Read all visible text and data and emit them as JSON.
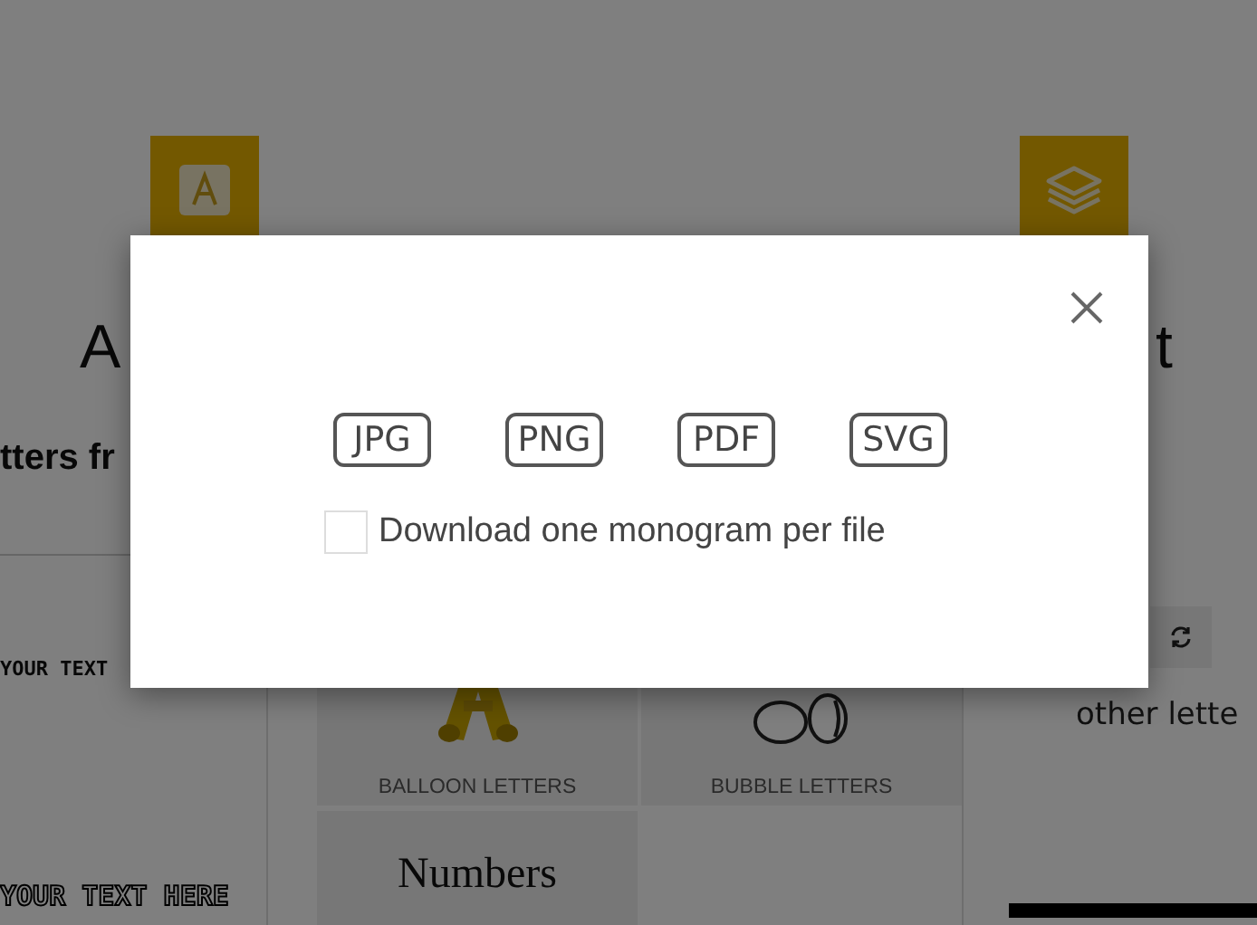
{
  "page": {
    "left_card": {
      "title": "A",
      "subtitle": "tters fr"
    },
    "right_card": {
      "title": "t"
    },
    "samples": [
      "YOUR TEXT",
      "YOUR TEXT HERE"
    ],
    "tiles": [
      {
        "kind": "balloon",
        "label": "BALLOON LETTERS"
      },
      {
        "kind": "bubble",
        "label": "BUBBLE LETTERS"
      },
      {
        "kind": "text",
        "title": "Numbers"
      }
    ],
    "right_text": "other lette"
  },
  "modal": {
    "formats": [
      "JPG",
      "PNG",
      "PDF",
      "SVG"
    ],
    "option": {
      "label": "Download one monogram per file",
      "checked": false
    }
  }
}
